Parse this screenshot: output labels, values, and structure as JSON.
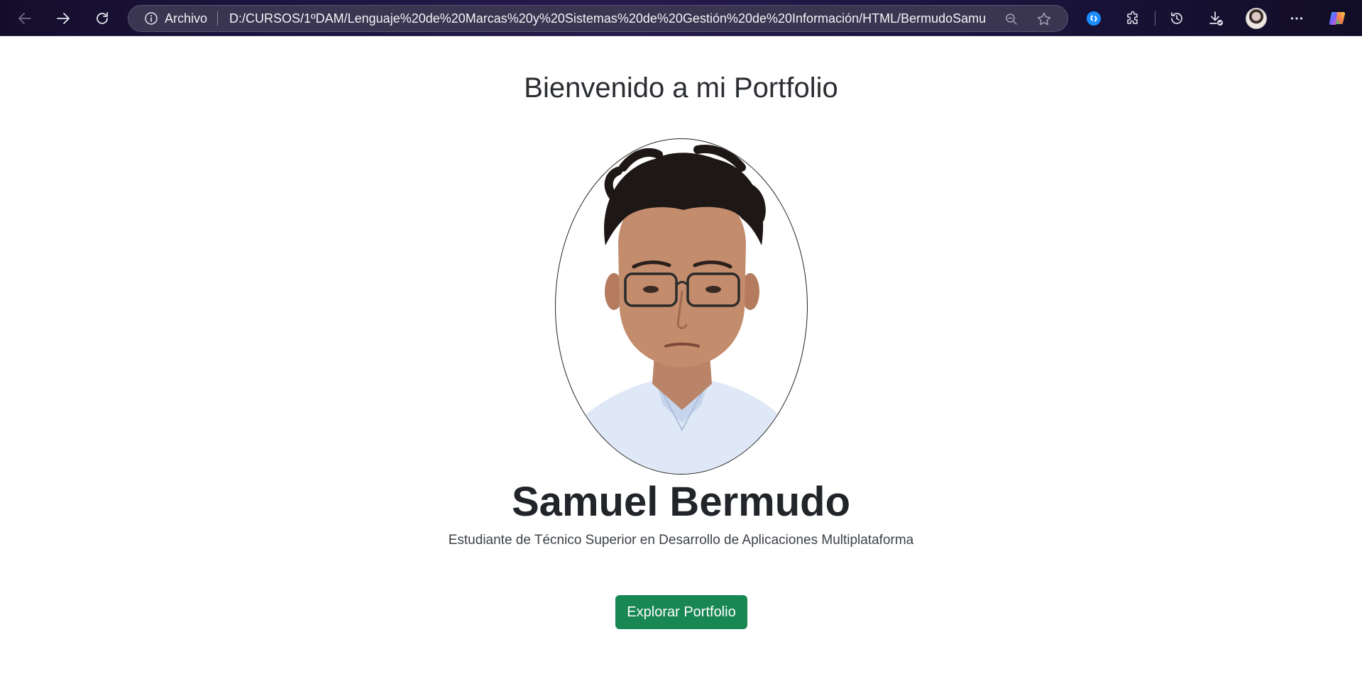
{
  "browser": {
    "site_label": "Archivo",
    "url": "D:/CURSOS/1ºDAM/Lenguaje%20de%20Marcas%20y%20Sistemas%20de%20Gestión%20de%20Información/HTML/BermudoSamuel_Bo...",
    "icons": {
      "back": "back-arrow-icon",
      "forward": "forward-arrow-icon",
      "reload": "reload-icon",
      "info": "info-icon",
      "zoom": "zoom-out-icon",
      "favorite": "star-icon",
      "shazam": "shazam-icon",
      "extensions": "puzzle-icon",
      "history": "history-icon",
      "downloads": "download-icon",
      "profile": "avatar",
      "more": "more-icon",
      "copilot": "copilot-icon"
    }
  },
  "page": {
    "welcome_title": "Bienvenido a mi Portfolio",
    "name": "Samuel Bermudo",
    "subtitle": "Estudiante de Técnico Superior en Desarrollo de Aplicaciones Multiplataforma",
    "cta_label": "Explorar Portfolio"
  },
  "colors": {
    "cta_background": "#198754",
    "chrome_background": "#1d1540",
    "text_dark": "#212529"
  }
}
